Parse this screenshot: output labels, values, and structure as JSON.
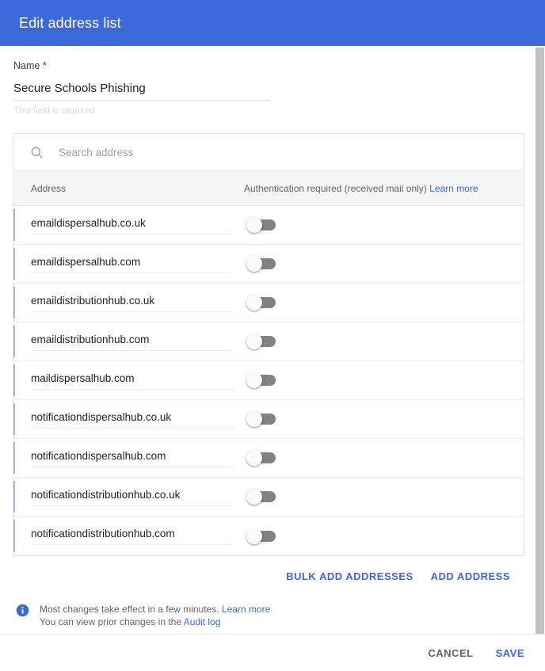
{
  "header": {
    "title": "Edit address list"
  },
  "name_field": {
    "label": "Name *",
    "value": "Secure Schools Phishing",
    "placeholder": "",
    "helper": "This field is required."
  },
  "search": {
    "placeholder": "Search address",
    "value": "",
    "icon": "search-icon"
  },
  "table": {
    "col_address": "Address",
    "col_auth": "Authentication required (received mail only)",
    "col_auth_link": "Learn more",
    "rows": [
      {
        "address": "emaildispersalhub.co.uk",
        "auth_enabled": false
      },
      {
        "address": "emaildispersalhub.com",
        "auth_enabled": false
      },
      {
        "address": "emaildistributionhub.co.uk",
        "auth_enabled": false
      },
      {
        "address": "emaildistributionhub.com",
        "auth_enabled": false
      },
      {
        "address": "maildispersalhub.com",
        "auth_enabled": false
      },
      {
        "address": "notificationdispersalhub.co.uk",
        "auth_enabled": false
      },
      {
        "address": "notificationdispersalhub.com",
        "auth_enabled": false
      },
      {
        "address": "notificationdistributionhub.co.uk",
        "auth_enabled": false
      },
      {
        "address": "notificationdistributionhub.com",
        "auth_enabled": false
      }
    ]
  },
  "card_actions": {
    "bulk_add": "BULK ADD ADDRESSES",
    "add_address": "ADD ADDRESS"
  },
  "notice": {
    "icon": "info-icon",
    "line1": "Most changes take effect in a few minutes.",
    "line1_link": "Learn more",
    "line2": "You can view prior changes in the",
    "line2_link": "Audit log"
  },
  "footer": {
    "cancel": "CANCEL",
    "save": "SAVE"
  },
  "colors": {
    "header_blue": "#3b69d9",
    "link_blue": "#3b69d9",
    "row_accent": "#a4b4e4",
    "toggle_track_off": "#808285",
    "table_head_bg": "#f5f5f5"
  }
}
